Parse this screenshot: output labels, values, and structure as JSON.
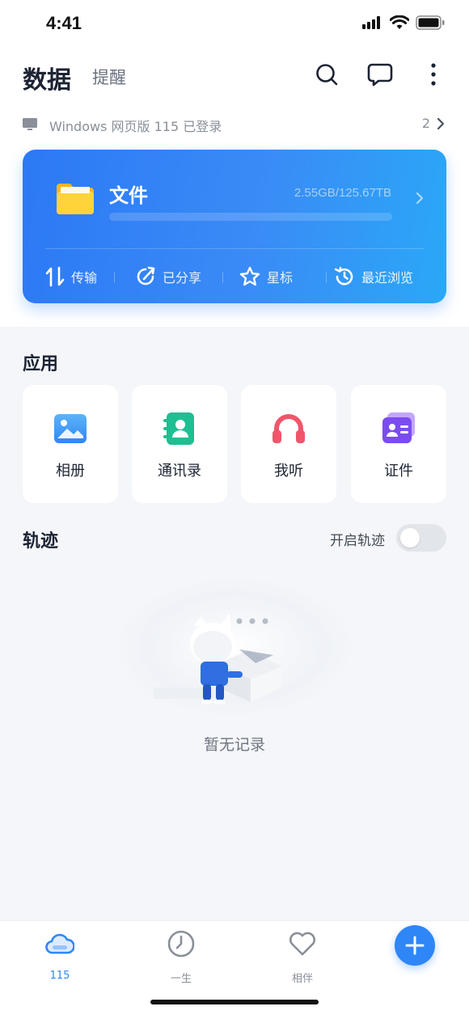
{
  "status_bar": {
    "time": "4:41"
  },
  "header": {
    "title": "数据",
    "tab": "提醒"
  },
  "login_notice": {
    "text": "Windows 网页版 115 已登录",
    "count": "2"
  },
  "files_card": {
    "title": "文件",
    "usage": "2.55GB/125.67TB",
    "usage_fraction": 0.0,
    "actions": [
      {
        "label": "传输",
        "icon": "transfer-icon"
      },
      {
        "label": "已分享",
        "icon": "share-icon"
      },
      {
        "label": "星标",
        "icon": "star-icon"
      },
      {
        "label": "最近浏览",
        "icon": "history-icon"
      }
    ]
  },
  "apps": {
    "title": "应用",
    "items": [
      {
        "label": "相册",
        "icon": "album-icon"
      },
      {
        "label": "通讯录",
        "icon": "contacts-icon"
      },
      {
        "label": "我听",
        "icon": "headphones-icon"
      },
      {
        "label": "证件",
        "icon": "id-card-icon"
      }
    ]
  },
  "track": {
    "title": "轨迹",
    "toggle_label": "开启轨迹",
    "toggle_on": false,
    "empty_text": "暂无记录"
  },
  "tab_bar": {
    "items": [
      {
        "label": "115",
        "icon": "cloud-icon",
        "active": true
      },
      {
        "label": "一生",
        "icon": "clock-icon",
        "active": false
      },
      {
        "label": "相伴",
        "icon": "heart-icon",
        "active": false
      }
    ]
  },
  "colors": {
    "accent": "#2f86f6",
    "card_start": "#2c79f5",
    "card_end": "#2aa8f7"
  }
}
